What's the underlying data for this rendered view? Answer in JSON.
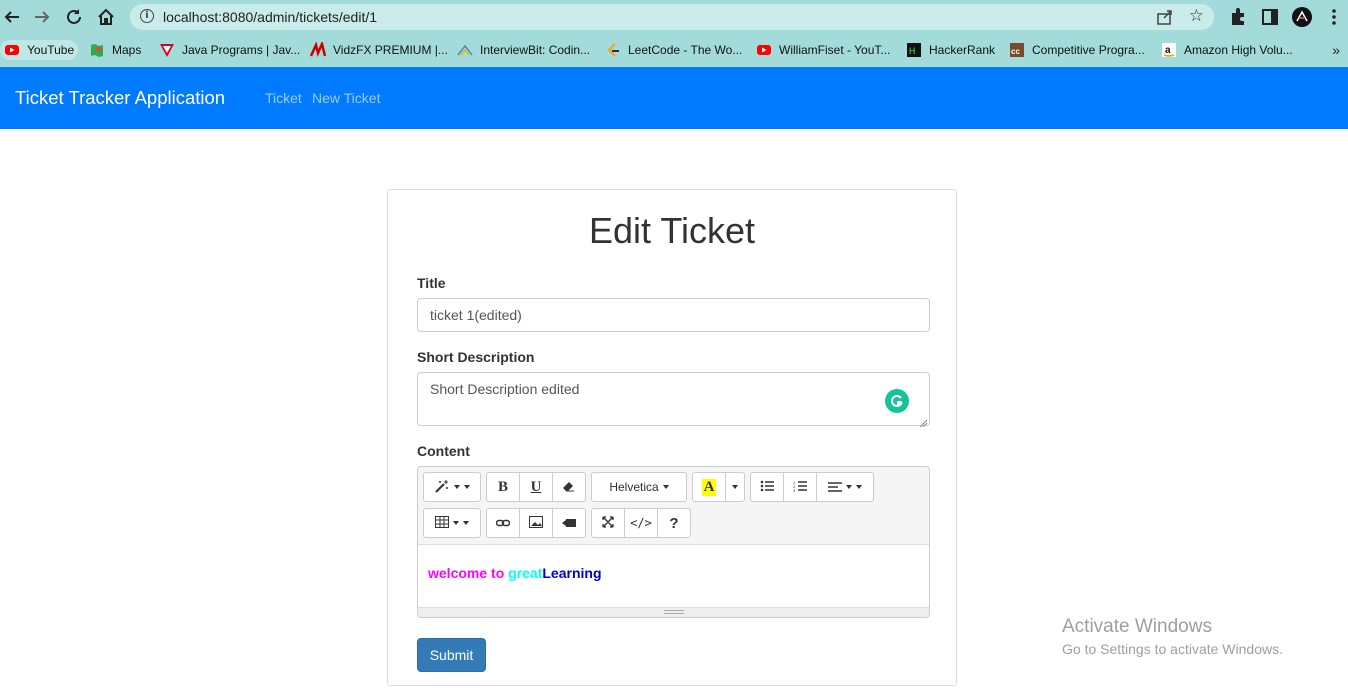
{
  "browser": {
    "url": "localhost:8080/admin/tickets/edit/1",
    "bookmarks": [
      {
        "label": "YouTube",
        "color": "#ff0000"
      },
      {
        "label": "Maps",
        "color": "#34a853"
      },
      {
        "label": "Java Programs | Jav...",
        "color": "#e0001b"
      },
      {
        "label": "VidzFX PREMIUM |...",
        "color": "#cc0000"
      },
      {
        "label": "InterviewBit: Codin...",
        "color": "#4b8bbe"
      },
      {
        "label": "LeetCode - The Wo...",
        "color": "#ffa116"
      },
      {
        "label": "WilliamFiset - YouT...",
        "color": "#ff0000"
      },
      {
        "label": "HackerRank",
        "color": "#1ba94c"
      },
      {
        "label": "Competitive Progra...",
        "color": "#8b4513"
      },
      {
        "label": "Amazon High Volu...",
        "color": "#ff9900"
      }
    ]
  },
  "navbar": {
    "brand": "Ticket Tracker Application",
    "links": [
      "Ticket",
      "New Ticket"
    ],
    "bg_color": "#007bff"
  },
  "form": {
    "heading": "Edit Ticket",
    "title_label": "Title",
    "title_value": "ticket 1(edited)",
    "short_desc_label": "Short Description",
    "short_desc_value": "Short Description edited",
    "content_label": "Content",
    "font_name": "Helvetica",
    "content_segments": [
      {
        "text": "welcome to ",
        "color": "#ff00ff"
      },
      {
        "text": "great",
        "color": "#00ffff"
      },
      {
        "text": "Learning",
        "color": "#0000cc"
      }
    ],
    "submit_label": "Submit",
    "submit_color": "#337ab7"
  },
  "watermark": {
    "line1": "Activate Windows",
    "line2": "Go to Settings to activate Windows."
  }
}
